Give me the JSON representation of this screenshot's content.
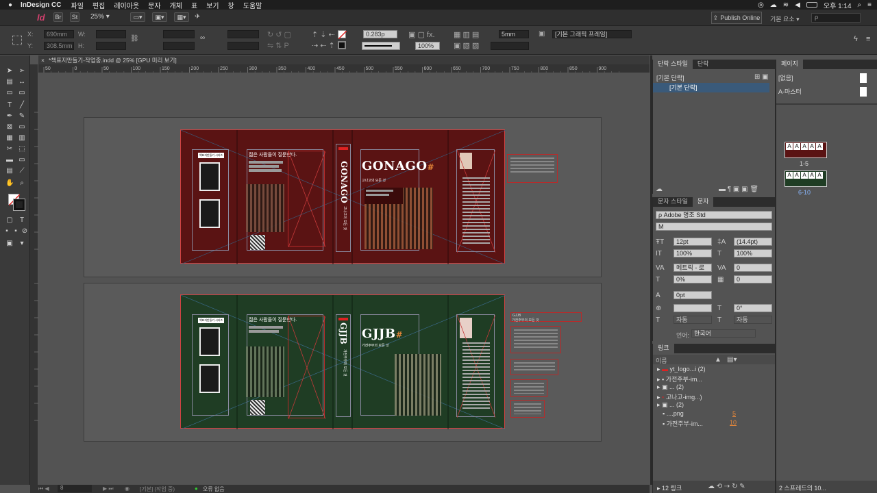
{
  "menubar": {
    "app_name": "InDesign CC",
    "items": [
      "파일",
      "편집",
      "레이아웃",
      "문자",
      "개체",
      "표",
      "보기",
      "창",
      "도움말"
    ],
    "clock": "오후 1:14"
  },
  "appbar": {
    "app_logo": "Id",
    "zoom": "25%",
    "publish_online": "Publish Online",
    "workspace": "기본 요소",
    "search_placeholder": "ρ"
  },
  "control": {
    "x_label": "X:",
    "y_label": "Y:",
    "w_label": "W:",
    "h_label": "H:",
    "x_value": "690mm",
    "y_value": "308.5mm",
    "stroke_weight": "0.283p",
    "opacity": "100%",
    "gap": "5mm",
    "frame_style": "[기본 그래픽 프레임]"
  },
  "document": {
    "tab_title": "*책표지만들기-작업중.indd @ 25% [GPU 미리 보기]",
    "ruler_ticks": [
      "50",
      "0",
      "50",
      "100",
      "150",
      "200",
      "250",
      "300",
      "350",
      "400",
      "450",
      "500",
      "550",
      "600",
      "650",
      "700",
      "750",
      "800",
      "850",
      "900"
    ]
  },
  "cover_red": {
    "title": "GONAGO",
    "spine": "GONAGO",
    "subtitle": "고나고의 모든 것",
    "headline": "젊은 사람들이 질문한다.",
    "back_label": "책표지만들기 시리즈"
  },
  "cover_green": {
    "title": "GJJB",
    "spine": "GJJB",
    "subtitle": "가전주부의 모든 것",
    "headline": "젊은 사람들이 질문한다.",
    "back_label": "책표지만들기 시리즈",
    "side_note_title": "GJJB",
    "side_note_sub": "가전주부의 모든 것"
  },
  "status": {
    "page_field": "8",
    "style": "[기본] (작업 중)",
    "errors": "오류 없음"
  },
  "paragraph_styles": {
    "tab_active": "단락 스타일",
    "tab_inactive": "단락",
    "header": "[기본 단락]",
    "item": "[기본 단락]"
  },
  "pages": {
    "tab": "페이지",
    "none": "[없음]",
    "master": "A-마스터",
    "spread1_label": "1-5",
    "spread2_label": "6-10",
    "footer": "2 스프레드의 10..."
  },
  "character": {
    "tab_inactive": "문자 스타일",
    "tab_active": "문자",
    "font": "Adobe 명조 Std",
    "style": "M",
    "size": "12pt",
    "leading": "(14.4pt)",
    "vscale": "100%",
    "hscale": "100%",
    "kerning": "메트릭 - 로",
    "tracking": "0",
    "baseline": "0%",
    "skew_val": "0",
    "shift": "0pt",
    "rotate": "0°",
    "auto1": "자동",
    "auto2": "자동",
    "language_label": "언어:",
    "language": "한국어"
  },
  "links": {
    "tab": "링크",
    "col_name": "이름",
    "items": [
      {
        "name": "yt_logo...i (2)",
        "num": ""
      },
      {
        "name": "가전주부-im...",
        "num": ""
      },
      {
        "name": "... (2)",
        "num": ""
      },
      {
        "name": "고나고-img...)",
        "num": ""
      },
      {
        "name": "... (2)",
        "num": ""
      },
      {
        "name": "....png",
        "num": "5"
      },
      {
        "name": "가전주부-im...",
        "num": "10"
      }
    ],
    "footer": "12 링크"
  },
  "colors": {
    "red_cover": "#5a1313",
    "green_cover": "#1f3d24",
    "accent_orange": "#e8883a",
    "frame_red": "#c63a3a"
  }
}
